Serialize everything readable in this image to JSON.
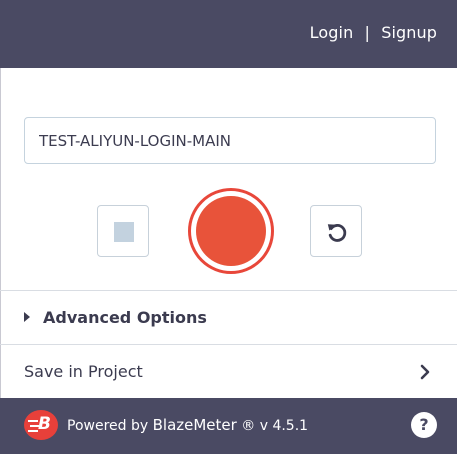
{
  "header": {
    "login": "Login",
    "separator": "|",
    "signup": "Signup"
  },
  "recorder": {
    "test_name": "TEST-ALIYUN-LOGIN-MAIN",
    "stop_icon": "stop-icon",
    "record_icon": "record-icon",
    "reset_icon": "reset-icon"
  },
  "advanced": {
    "label": "Advanced Options",
    "icon": "caret-right-icon"
  },
  "save": {
    "label": "Save in Project",
    "icon": "chevron-right-icon"
  },
  "footer": {
    "powered_by": "Powered by",
    "brand": "BlazeMeter",
    "registered": "®",
    "version": "v 4.5.1",
    "help": "?"
  },
  "colors": {
    "header_bg": "#4a4a63",
    "record_red": "#e8533a",
    "logo_red": "#e8403a"
  }
}
